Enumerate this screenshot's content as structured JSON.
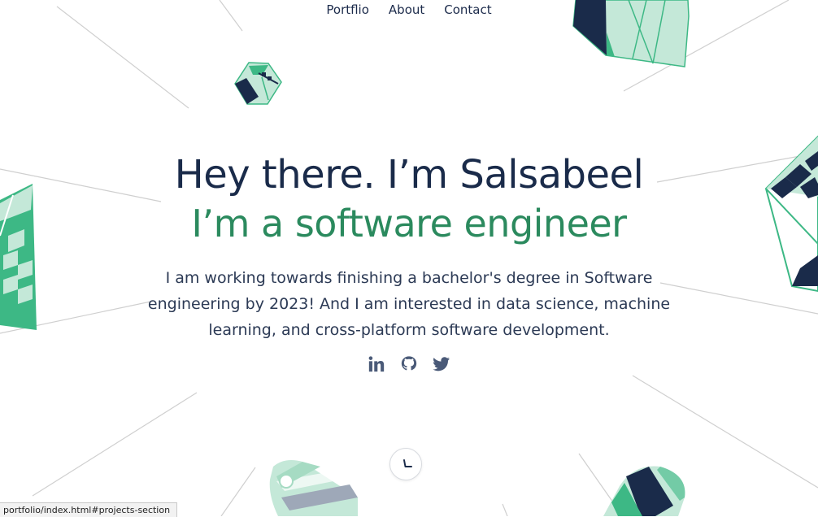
{
  "nav": {
    "items": [
      {
        "label": "Portflio"
      },
      {
        "label": "About"
      },
      {
        "label": "Contact"
      }
    ]
  },
  "hero": {
    "title": "Hey there. I’m Salsabeel",
    "subtitle": "I’m a software engineer",
    "description": "I am working towards finishing a bachelor's degree in Software engineering by 2023! And I am interested in data science, machine learning, and cross-platform software development."
  },
  "socials": [
    {
      "icon": "linkedin-icon"
    },
    {
      "icon": "github-icon"
    },
    {
      "icon": "twitter-icon"
    }
  ],
  "scroll_button": {
    "icon": "clock-chevron-icon"
  },
  "status_bar": {
    "url": "portfolio/index.html#projects-section"
  },
  "colors": {
    "navy": "#1a2b4a",
    "green": "#2b8a5e",
    "mint": "#c4e8d8",
    "accent_green": "#3db885",
    "line_gray": "#c8c8c8"
  }
}
